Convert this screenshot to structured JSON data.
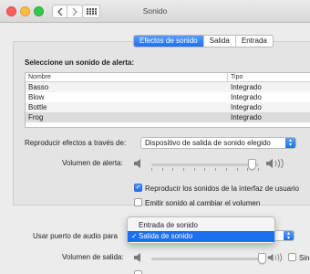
{
  "window": {
    "title": "Sonido"
  },
  "tabs": [
    {
      "label": "Efectos de sonido",
      "active": true
    },
    {
      "label": "Salida",
      "active": false
    },
    {
      "label": "Entrada",
      "active": false
    }
  ],
  "alert": {
    "heading": "Seleccione un sonido de alerta:",
    "columns": [
      "Nombre",
      "Tipo"
    ],
    "rows": [
      {
        "name": "Basso",
        "type": "Integrado"
      },
      {
        "name": "Blow",
        "type": "Integrado"
      },
      {
        "name": "Bottle",
        "type": "Integrado"
      },
      {
        "name": "Frog",
        "type": "Integrado",
        "selected": true
      }
    ]
  },
  "play_through": {
    "label": "Reproducir efectos a través de:",
    "value": "Dispositivo de salida de sonido elegido"
  },
  "alert_volume": {
    "label": "Volumen de alerta:",
    "level": 0.9
  },
  "checks": {
    "ui_sounds": {
      "label": "Reproducir los sonidos de la interfaz de usuario",
      "checked": true
    },
    "volume_feedback": {
      "label": "Emitir sonido al cambiar el volumen",
      "checked": false
    }
  },
  "audio_port": {
    "label": "Usar puerto de audio para",
    "options": [
      "Entrada de sonido",
      "Salida de sonido"
    ],
    "selected": "Salida de sonido"
  },
  "output_volume": {
    "label": "Volumen de salida:",
    "level": 0.9,
    "mute_label": "Sin"
  },
  "accent_color": "#1d6ff2"
}
